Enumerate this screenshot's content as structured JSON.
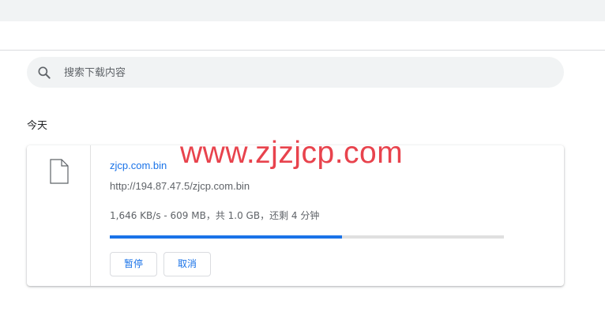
{
  "search": {
    "placeholder": "搜索下载内容"
  },
  "section": {
    "title": "今天"
  },
  "watermark": "www.zjzjcp.com",
  "download": {
    "filename": "zjcp.com.bin",
    "url": "http://194.87.47.5/zjcp.com.bin",
    "status": "1,646 KB/s - 609 MB，共 1.0 GB，还剩 4 分钟",
    "progress_fraction": 0.59,
    "pause_label": "暂停",
    "cancel_label": "取消"
  },
  "colors": {
    "accent": "#1a73e8",
    "watermark": "#e8434d",
    "track": "#e0e0e0"
  }
}
